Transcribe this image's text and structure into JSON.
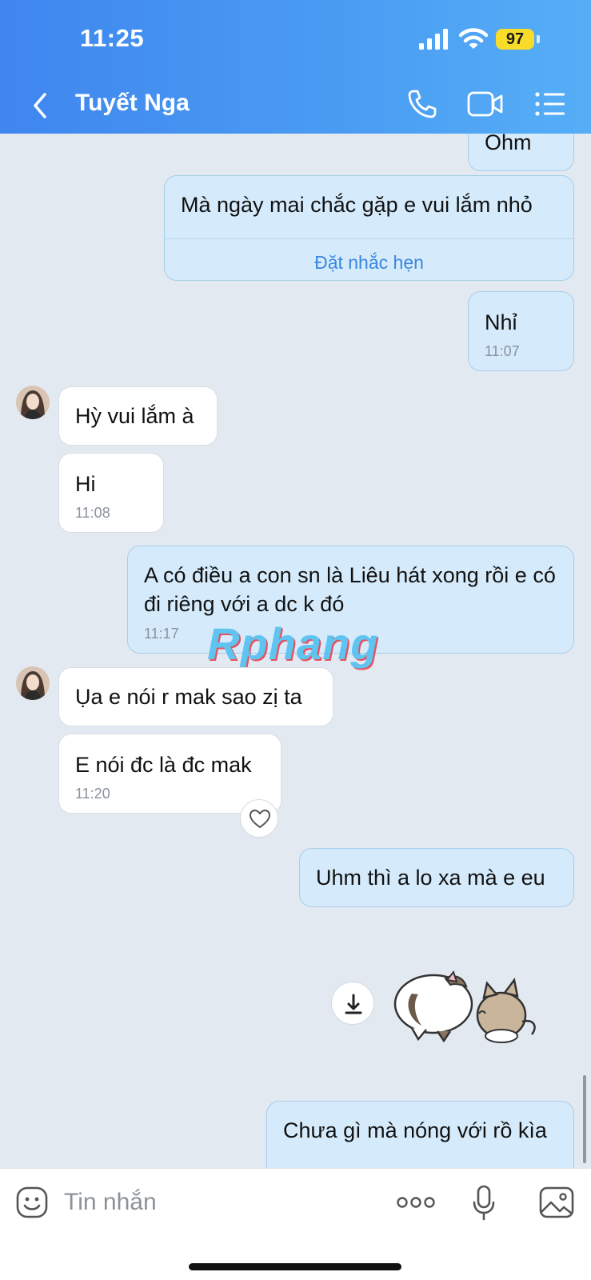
{
  "status_bar": {
    "time": "11:25",
    "battery": "97"
  },
  "header": {
    "contact_name": "Tuyết Nga"
  },
  "messages": {
    "m1": {
      "text": "Ohm"
    },
    "m2": {
      "text": "Mà ngày mai chắc gặp e vui lắm nhỏ",
      "action": "Đặt nhắc hẹn"
    },
    "m3": {
      "text": "Nhỉ",
      "time": "11:07"
    },
    "m4": {
      "text": "Hỳ vui lắm à"
    },
    "m5": {
      "text": "Hi",
      "time": "11:08"
    },
    "m6": {
      "text": "A có điều a con sn là Liêu hát xong rồi e có đi riêng với a dc k đó",
      "time": "11:17"
    },
    "m7": {
      "text": "Ụa e nói r mak sao zị ta"
    },
    "m8": {
      "text": "E nói đc là đc mak",
      "time": "11:20"
    },
    "m9": {
      "text": "Uhm thì a lo xa mà e eu"
    },
    "m10": {
      "text": "Chưa gì mà nóng với rồ kìa"
    }
  },
  "watermark": "Rphang",
  "composer": {
    "placeholder": "Tin nhắn"
  },
  "colors": {
    "header": "#4a9df3",
    "sent_bubble": "#d5ebfb",
    "received_bubble": "#ffffff",
    "background": "#e2e9f1",
    "battery": "#f9dc2a",
    "link": "#3b86e0"
  }
}
